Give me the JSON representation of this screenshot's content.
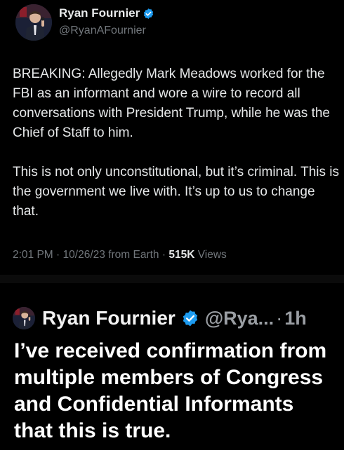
{
  "tweet1": {
    "name": "Ryan Fournier",
    "handle": "@RyanAFournier",
    "paragraphs": [
      "BREAKING: Allegedly Mark Meadows worked for the FBI as an informant and wore a wire to record all conversations with President Trump, while he was the Chief of Staff to him.",
      "This is not only unconstitutional, but it’s criminal. This is the government we live with. It’s up to us to change that."
    ],
    "meta": {
      "time": "2:01 PM",
      "date": "10/26/23",
      "source": "from Earth",
      "sep": "·",
      "views_count": "515K",
      "views_label": "Views"
    }
  },
  "tweet2": {
    "name": "Ryan Fournier",
    "handle": "@Rya...",
    "sep": "·",
    "time": "1h",
    "text": "I’ve received confirmation from multiple members of Congress and Confidential Informants that this is true."
  },
  "colors": {
    "background": "#000000",
    "text": "#e7e9ea",
    "muted": "#71767b",
    "verified": "#1d9bf0"
  },
  "icons": {
    "verified": "verified-badge-icon",
    "avatar": "profile-photo"
  }
}
